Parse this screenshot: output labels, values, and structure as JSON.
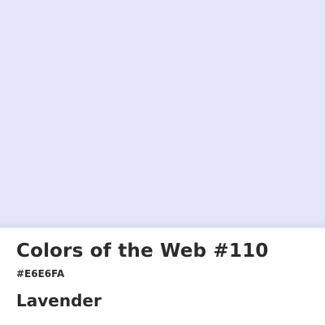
{
  "card": {
    "title": "Colors of the Web #110",
    "hex_label": "#E6E6FA",
    "color_name": "Lavender"
  },
  "colors": {
    "swatch": "#E6E6FA",
    "text": "#2B2B2B",
    "background": "#FFFFFF"
  }
}
